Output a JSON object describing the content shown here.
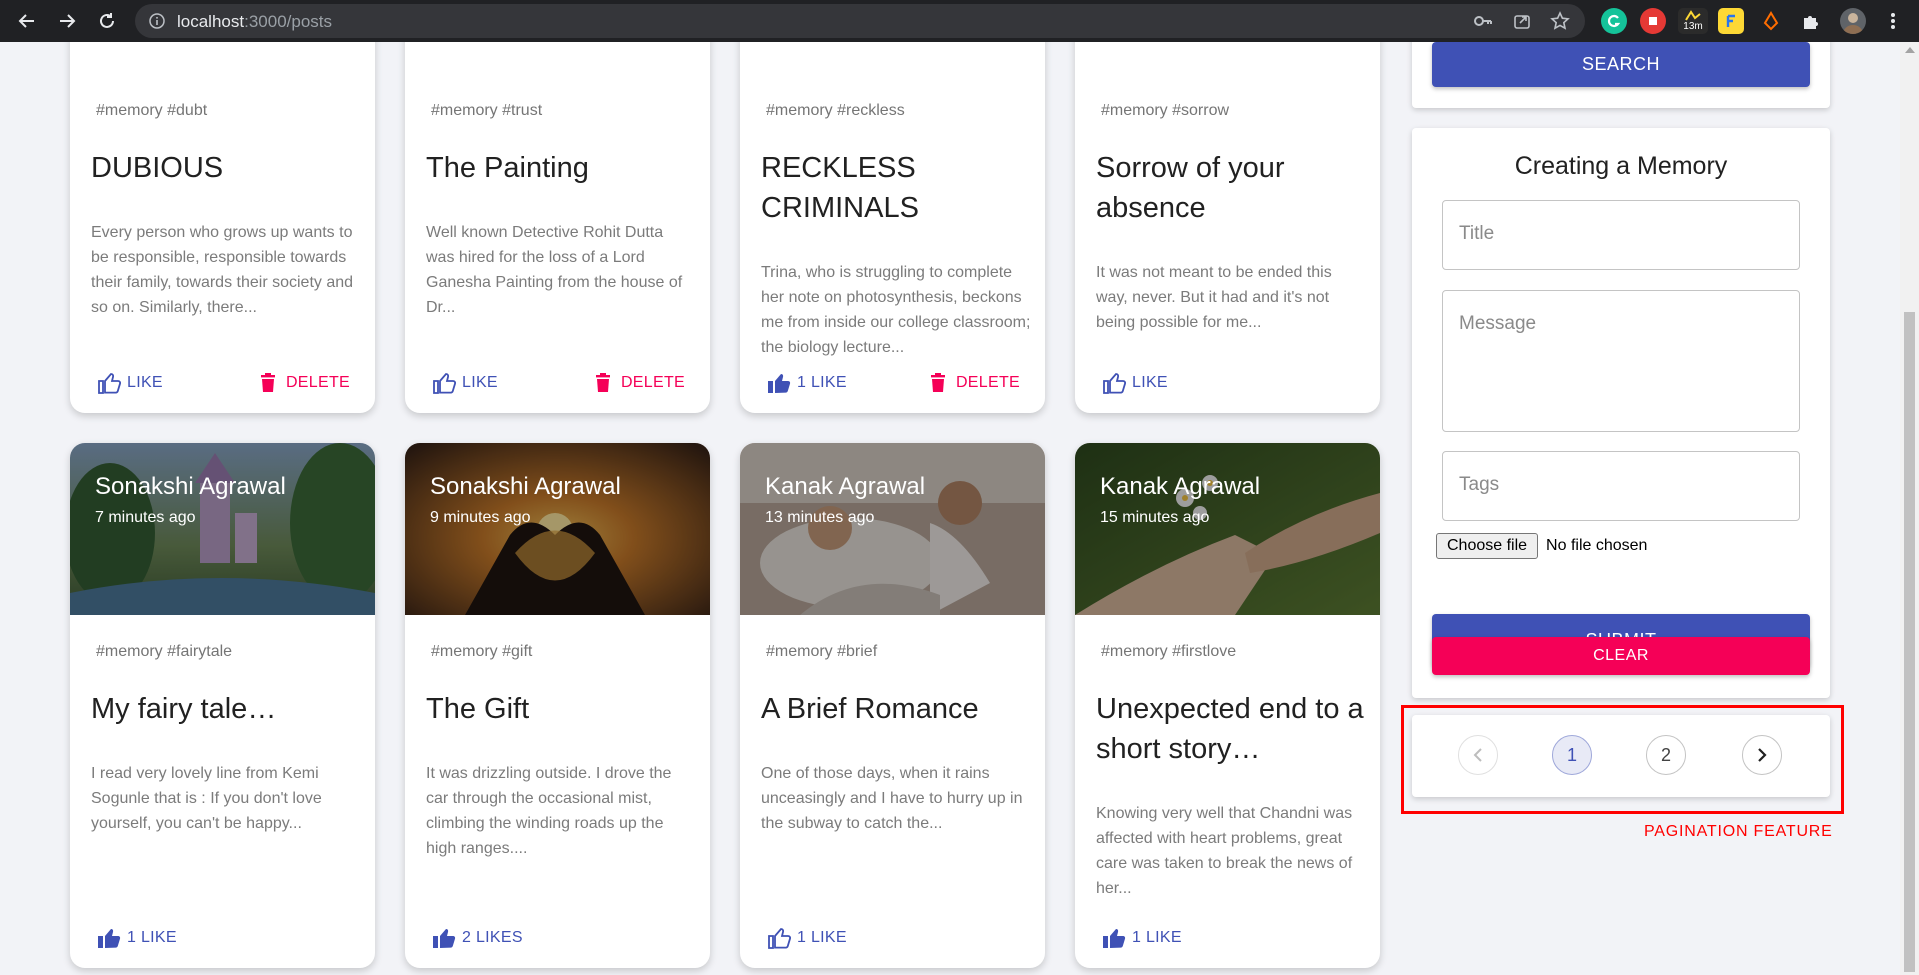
{
  "browser": {
    "url_host": "localhost",
    "url_path": ":3000/posts",
    "ext_timer_label": "13m"
  },
  "top_cards": [
    {
      "tags": "#memory #dubt",
      "title": "DUBIOUS",
      "message": "Every person who grows up wants to be responsible, responsible towards their family, towards their society and so on. Similarly, there...",
      "like_label": "LIKE",
      "like_filled": false,
      "delete_label": "DELETE",
      "show_delete": true
    },
    {
      "tags": "#memory #trust",
      "title": "The Painting",
      "message": "Well known Detective Rohit Dutta was hired for the loss of a Lord Ganesha Painting from the house of Dr...",
      "like_label": "LIKE",
      "like_filled": false,
      "delete_label": "DELETE",
      "show_delete": true
    },
    {
      "tags": "#memory #reckless",
      "title": "RECKLESS CRIMINALS",
      "message": "Trina, who is struggling to complete her note on photosynthesis, beckons me from inside our college classroom; the biology lecture...",
      "like_label": "1 LIKE",
      "like_filled": true,
      "delete_label": "DELETE",
      "show_delete": true
    },
    {
      "tags": "#memory #sorrow",
      "title": "Sorrow of your absence",
      "message": "It was not meant to be ended this way, never. But it had and it's not being possible for me...",
      "like_label": "LIKE",
      "like_filled": false,
      "delete_label": "",
      "show_delete": false
    }
  ],
  "bottom_cards": [
    {
      "creator": "Sonakshi Agrawal",
      "time": "7 minutes ago",
      "tags": "#memory #fairytale",
      "title": "My fairy tale…",
      "message": "I read very lovely line from Kemi Sogunle that is : If you don't love yourself, you can't be happy...",
      "like_label": "1 LIKE",
      "like_filled": true,
      "image_theme": "fairytale"
    },
    {
      "creator": "Sonakshi Agrawal",
      "time": "9 minutes ago",
      "tags": "#memory #gift",
      "title": "The Gift",
      "message": "It was drizzling outside. I drove the car through the occasional mist, climbing the winding roads up the high ranges....",
      "like_label": "2 LIKES",
      "like_filled": true,
      "image_theme": "sunset-heart"
    },
    {
      "creator": "Kanak Agrawal",
      "time": "13 minutes ago",
      "tags": "#memory #brief",
      "title": "A Brief Romance",
      "message": "One of those days, when it rains unceasingly and I have to hurry up in the subway to catch the...",
      "like_label": "1 LIKE",
      "like_filled": false,
      "image_theme": "couple"
    },
    {
      "creator": "Kanak Agrawal",
      "time": "15 minutes ago",
      "tags": "#memory #firstlove",
      "title": "Unexpected end to a short story…",
      "message": "Knowing very well that Chandni was affected with heart problems, great care was taken to break the news of her...",
      "like_label": "1 LIKE",
      "like_filled": true,
      "image_theme": "flowers"
    }
  ],
  "search": {
    "button_label": "SEARCH"
  },
  "form": {
    "heading": "Creating a Memory",
    "title_placeholder": "Title",
    "message_placeholder": "Message",
    "tags_placeholder": "Tags",
    "file_button_label": "Choose file",
    "file_status": "No file chosen",
    "submit_label": "SUBMIT",
    "clear_label": "CLEAR"
  },
  "pagination": {
    "pages": [
      "1",
      "2"
    ],
    "current_page": "1",
    "annotation": "PAGINATION FEATURE"
  },
  "colors": {
    "primary": "#3f51b5",
    "secondary": "#f50057",
    "annotation": "#ff0000"
  }
}
